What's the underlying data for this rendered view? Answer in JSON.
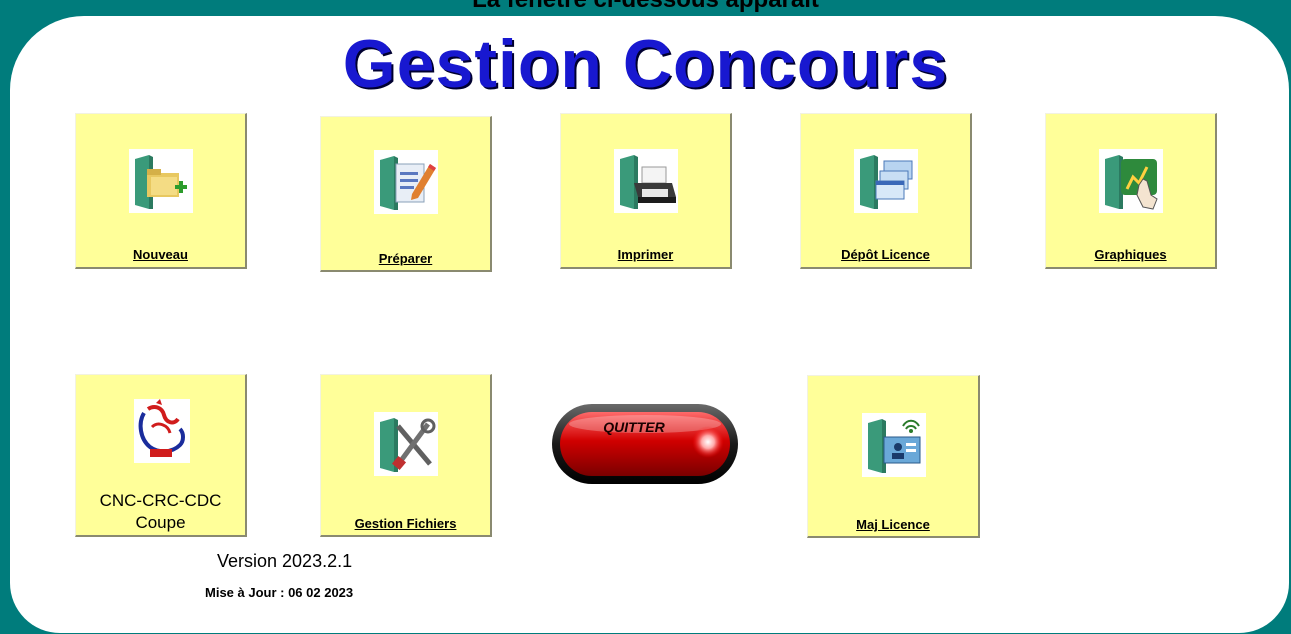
{
  "caption": "La fenêtre ci-dessous apparaît",
  "app": {
    "title": "Gestion Concours"
  },
  "tiles": {
    "nouveau": "Nouveau",
    "preparer": "Préparer",
    "imprimer": "Imprimer",
    "depot_licence": "Dépôt Licence",
    "graphiques": "Graphiques",
    "cnc_line1": "CNC-CRC-CDC",
    "cnc_line2": "Coupe",
    "gestion_fichiers": "Gestion Fichiers",
    "maj_licence": "Maj Licence"
  },
  "quit": {
    "label": "QUITTER"
  },
  "footer": {
    "version": "Version 2023.2.1",
    "update": "Mise à Jour : 06 02 2023"
  },
  "icons": {
    "nouveau": "folder-add-icon",
    "preparer": "document-edit-icon",
    "imprimer": "printer-icon",
    "depot_licence": "windows-stack-icon",
    "graphiques": "touch-chart-icon",
    "cnc": "rooster-logo-icon",
    "gestion_fichiers": "tools-icon",
    "maj_licence": "wireless-card-icon"
  },
  "colors": {
    "background": "#007c7c",
    "tile": "#ffff99",
    "title": "#1818d0",
    "quit": "#c00000"
  }
}
